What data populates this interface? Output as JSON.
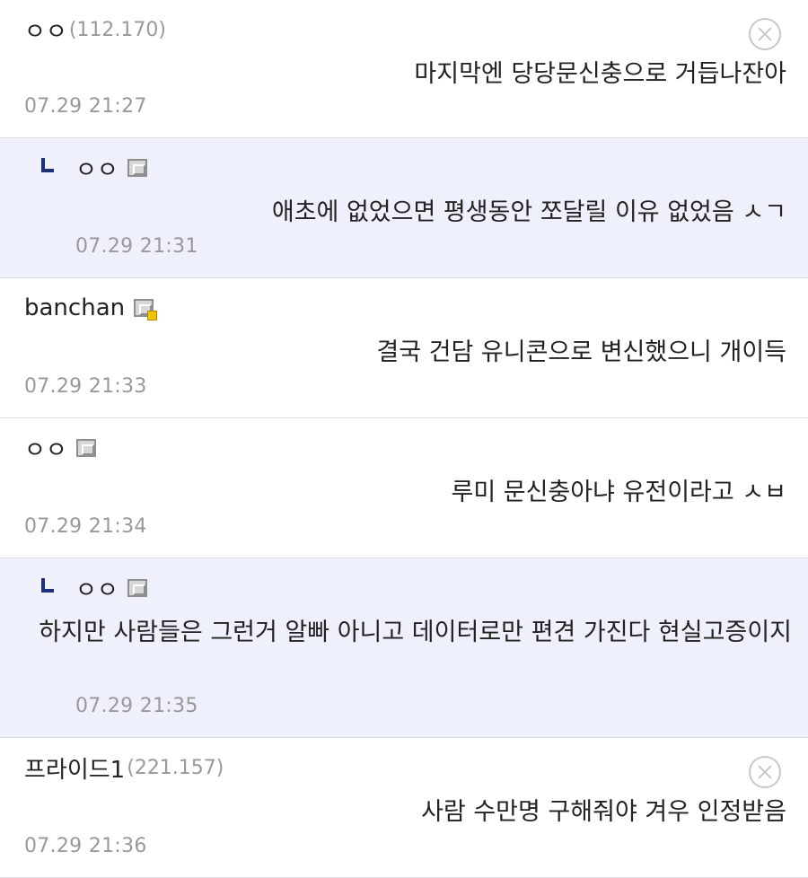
{
  "comments": [
    {
      "nick": "ㅇㅇ",
      "ip": "(112.170)",
      "text": "마지막엔 당당문신충으로 거듭나잔아",
      "time": "07.29 21:27",
      "icon": "delete-icon"
    },
    {
      "nick": "ㅇㅇ",
      "text": "애초에 없었으면 평생동안 쪼달릴 이유 없었음 ㅅㄱ",
      "time": "07.29 21:31",
      "icon": "member-badge-icon"
    },
    {
      "nick": "banchan",
      "text": "결국 건담 유니콘으로 변신했으니 개이득",
      "time": "07.29 21:33",
      "icon": "gold-member-badge-icon"
    },
    {
      "nick": "ㅇㅇ",
      "text": "루미 문신충아냐 유전이라고 ㅅㅂ",
      "time": "07.29 21:34",
      "icon": "member-badge-icon"
    },
    {
      "nick": "ㅇㅇ",
      "text": "하지만 사람들은 그런거 알빠 아니고 데이터로만 편견 가진다 현실고증이지",
      "time": "07.29 21:35",
      "icon": "member-badge-icon"
    },
    {
      "nick": "프라이드1",
      "ip": "(221.157)",
      "text": "사람 수만명 구해줘야 겨우 인정받음",
      "time": "07.29 21:36",
      "icon": "delete-icon"
    }
  ],
  "colors": {
    "reply_background": "#eef1fb",
    "meta_gray": "#999999",
    "divider": "#d9dce4",
    "reply_arrow": "#1f2f78"
  }
}
